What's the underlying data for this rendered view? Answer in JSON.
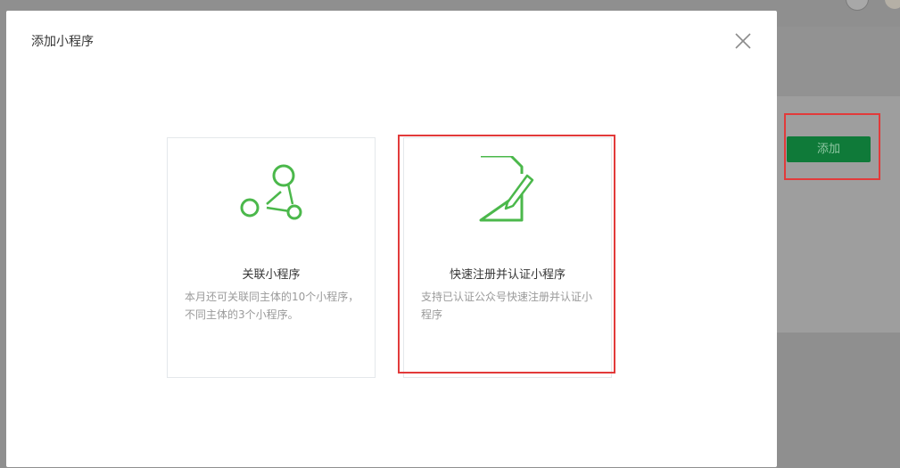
{
  "background": {
    "add_button_label": "添加"
  },
  "dialog": {
    "title": "添加小程序",
    "cards": [
      {
        "title": "关联小程序",
        "description": "本月还可关联同主体的10个小程序，不同主体的3个小程序。",
        "icon": "link-nodes-icon"
      },
      {
        "title": "快速注册并认证小程序",
        "description": "支持已认证公众号快速注册并认证小程序",
        "icon": "document-edit-icon"
      }
    ]
  },
  "colors": {
    "accent_green": "#4bb84b",
    "button_green": "#0f7a39",
    "highlight_red": "#e23a3a"
  }
}
